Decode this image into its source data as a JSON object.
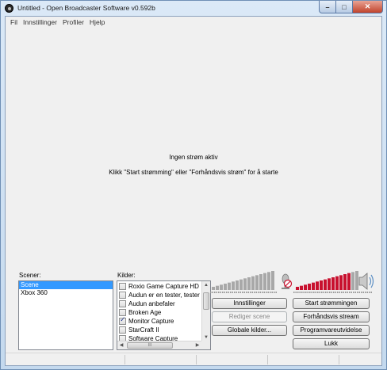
{
  "window": {
    "title": "Untitled - Open Broadcaster Software v0.592b",
    "controls": {
      "minimize": "–",
      "maximize": "□",
      "close": "✕"
    }
  },
  "menu": [
    "Fil",
    "Innstillinger",
    "Profiler",
    "Hjelp"
  ],
  "preview": {
    "status": "Ingen strøm aktiv",
    "hint": "Klikk \"Start strømming\" eller \"Forhåndsvis strøm\" for å starte"
  },
  "scenes": {
    "label": "Scener:",
    "items": [
      {
        "name": "Scene",
        "selected": true
      },
      {
        "name": "Xbox 360",
        "selected": false
      }
    ]
  },
  "sources": {
    "label": "Kilder:",
    "items": [
      {
        "name": "Roxio Game Capture HD",
        "checked": false
      },
      {
        "name": "Audun er en tester, tester de",
        "checked": false
      },
      {
        "name": "Audun anbefaler",
        "checked": false
      },
      {
        "name": "Broken Age",
        "checked": false
      },
      {
        "name": "Monitor Capture",
        "checked": true
      },
      {
        "name": "StarCraft II",
        "checked": false
      },
      {
        "name": "Software Capture",
        "checked": false
      }
    ],
    "hscroll_grip": "III"
  },
  "audio": {
    "mic_muted": true,
    "mic_level": 0.0,
    "desktop_level": 0.85,
    "colors": {
      "inactive": "#a8a8a8",
      "active": "#c8102e"
    },
    "mic_icon": "microphone-muted-icon",
    "speaker_icon": "speaker-icon"
  },
  "buttons": {
    "settings": "Innstillinger",
    "start_streaming": "Start strømmingen",
    "edit_scene": "Rediger scene",
    "preview_stream": "Forhåndsvis stream",
    "global_sources": "Globale kilder...",
    "program_info": "Programvareutvidelse",
    "exit": "Lukk"
  }
}
